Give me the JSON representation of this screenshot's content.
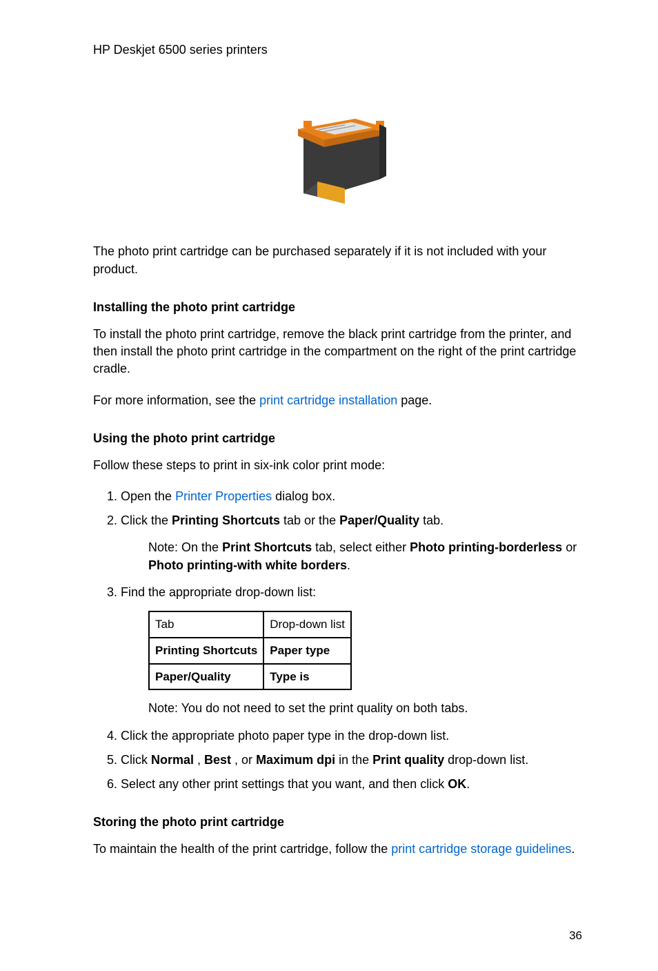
{
  "header": {
    "title": "HP Deskjet 6500 series printers"
  },
  "intro": "The photo print cartridge can be purchased separately if it is not included with your product.",
  "section1": {
    "heading": "Installing the photo print cartridge",
    "para1": "To install the photo print cartridge, remove the black print cartridge from the printer, and then install the photo print cartridge in the compartment on the right of the print cartridge cradle.",
    "para2_prefix": "For more information, see the ",
    "para2_link": "print cartridge installation",
    "para2_suffix": " page."
  },
  "section2": {
    "heading": "Using the photo print cartridge",
    "intro": "Follow these steps to print in six-ink color print mode:",
    "step1_prefix": "Open the ",
    "step1_link": "Printer Properties",
    "step1_suffix": " dialog box.",
    "step2_prefix": "Click the ",
    "step2_bold1": "Printing Shortcuts",
    "step2_mid": " tab or the ",
    "step2_bold2": "Paper/Quality",
    "step2_suffix": " tab.",
    "note1_label": "Note: ",
    "note1_prefix": "On the ",
    "note1_bold1": "Print Shortcuts",
    "note1_mid1": " tab, select either ",
    "note1_bold2": "Photo printing-borderless",
    "note1_mid2": " or ",
    "note1_bold3": "Photo printing-with white borders",
    "note1_suffix": ".",
    "step3": "Find the appropriate drop-down list:",
    "table": {
      "header1": "Tab",
      "header2": "Drop-down list",
      "row1_col1": "Printing Shortcuts",
      "row1_col2": "Paper type",
      "row2_col1": "Paper/Quality",
      "row2_col2": "Type is"
    },
    "note2_label": "Note: ",
    "note2_text": "You do not need to set the print quality on both tabs.",
    "step4": "Click the appropriate photo paper type in the drop-down list.",
    "step5_prefix": "Click ",
    "step5_bold1": "Normal",
    "step5_mid1": " , ",
    "step5_bold2": "Best",
    "step5_mid2": " , or ",
    "step5_bold3": "Maximum dpi",
    "step5_mid3": " in the ",
    "step5_bold4": "Print quality",
    "step5_suffix": " drop-down list.",
    "step6_prefix": "Select any other print settings that you want, and then click ",
    "step6_bold": "OK",
    "step6_suffix": "."
  },
  "section3": {
    "heading": "Storing the photo print cartridge",
    "para_prefix": "To maintain the health of the print cartridge, follow the ",
    "para_link": "print cartridge storage guidelines",
    "para_suffix": "."
  },
  "page_number": "36"
}
